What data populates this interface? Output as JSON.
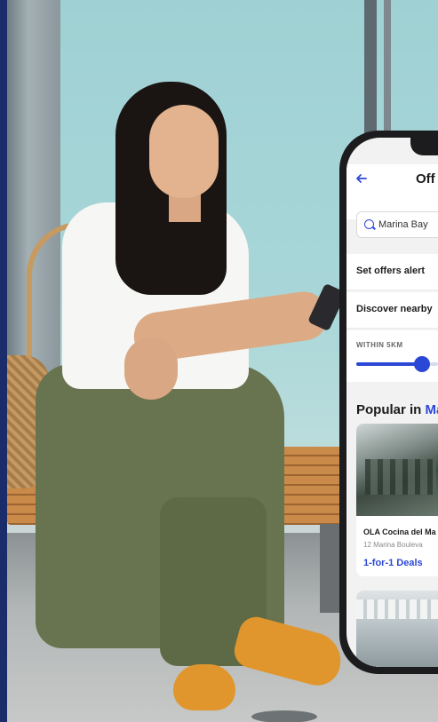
{
  "app": {
    "page_title": "Off",
    "back_icon": "arrow-left-icon",
    "search": {
      "value": "Marina Bay",
      "icon": "search-icon"
    },
    "rows": [
      {
        "label": "Set offers alert"
      },
      {
        "label": "Discover nearby"
      }
    ],
    "radius": {
      "label": "WITHIN 5KM",
      "level": 0.8
    },
    "popular": {
      "prefix": "Popular in ",
      "highlight": "Ma"
    },
    "cards": [
      {
        "name": "OLA Cocina del Ma",
        "address": "12 Marina Bouleva",
        "deal": "1-for-1 Deals"
      },
      {
        "name": "",
        "address": "",
        "deal": ""
      }
    ]
  },
  "colors": {
    "accent": "#2b47d6",
    "brand_strip": "#1b2c6b",
    "shoe": "#e0962c"
  }
}
